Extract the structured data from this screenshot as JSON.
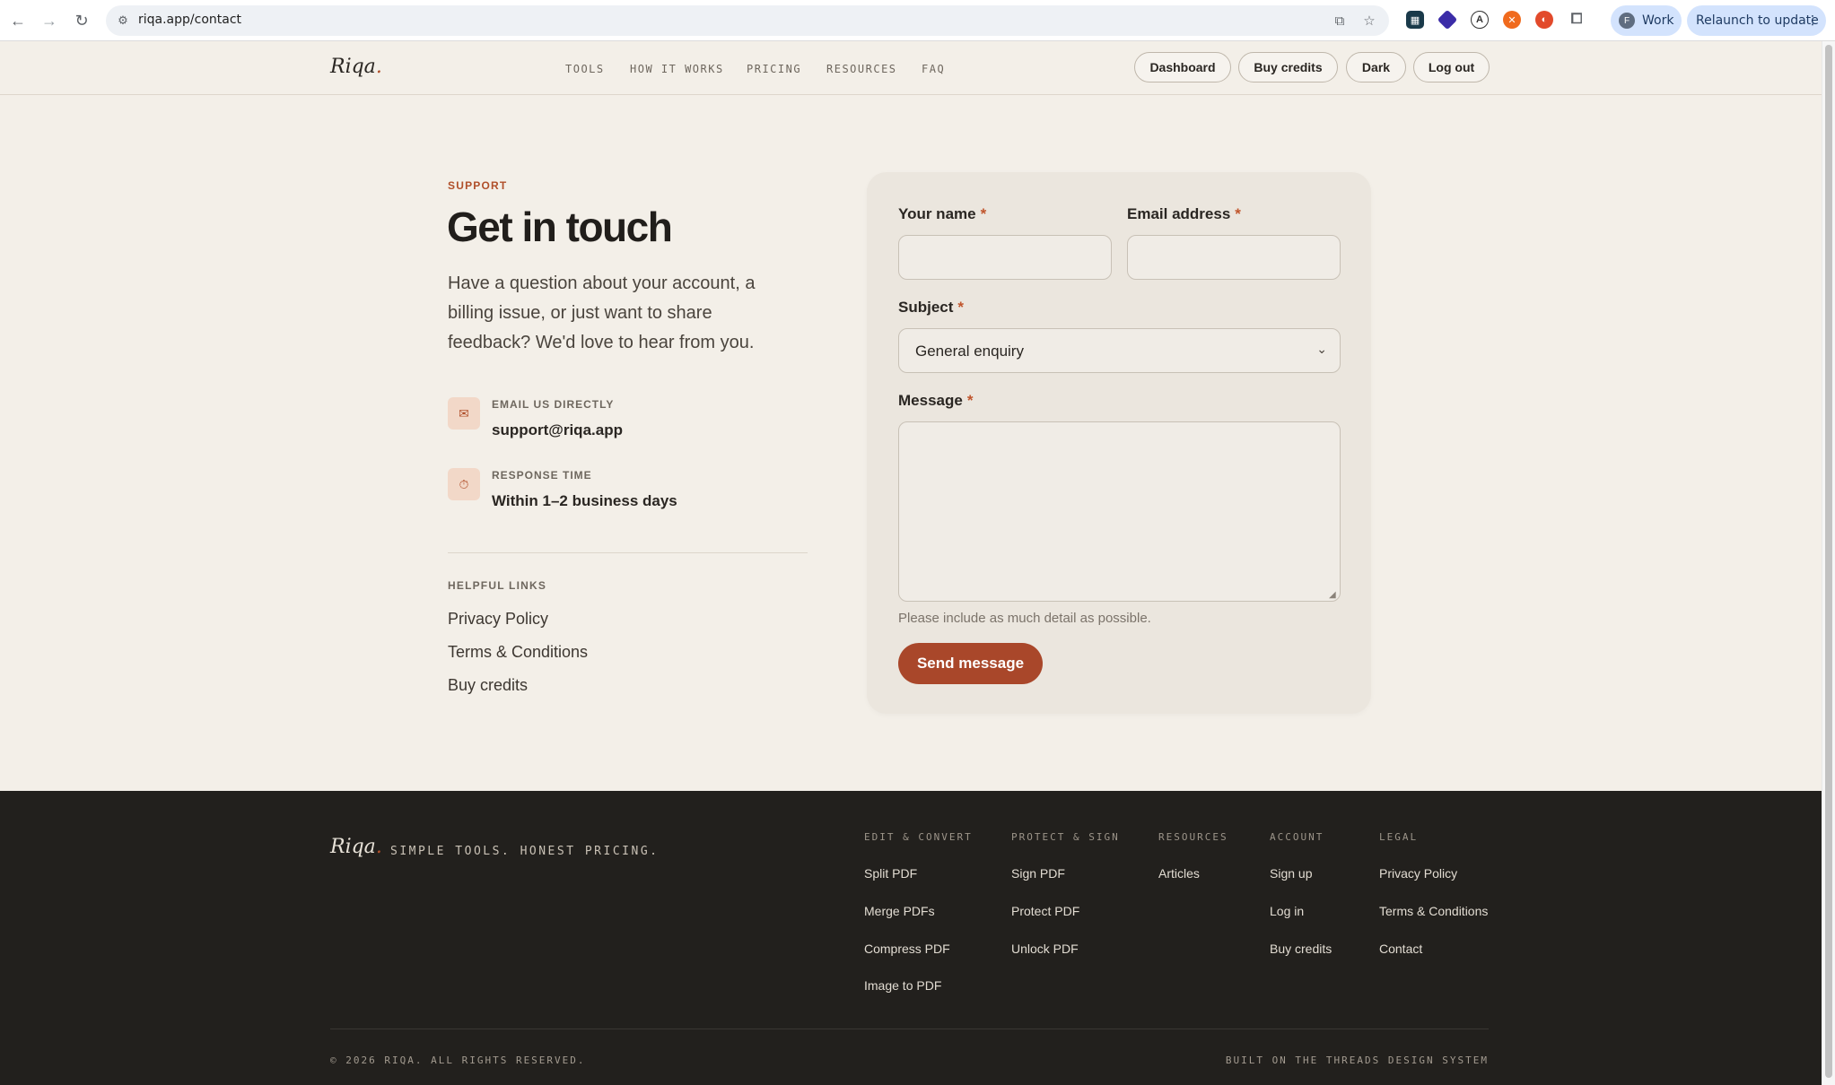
{
  "browser": {
    "url": "riqa.app/contact",
    "profile_initial": "F",
    "profile_label": "Work",
    "relaunch_label": "Relaunch to update"
  },
  "header": {
    "logo": "Riqa",
    "logo_dot": ".",
    "nav": [
      "TOOLS",
      "HOW IT WORKS",
      "PRICING",
      "RESOURCES",
      "FAQ"
    ],
    "buttons": [
      "Dashboard",
      "Buy credits",
      "Dark",
      "Log out"
    ]
  },
  "contact": {
    "eyebrow": "SUPPORT",
    "title": "Get in touch",
    "intro": "Have a question about your account, a billing issue, or just want to share feedback? We'd love to hear from you.",
    "email_label": "EMAIL US DIRECTLY",
    "email_value": "support@riqa.app",
    "response_label": "RESPONSE TIME",
    "response_value": "Within 1–2 business days",
    "helpful_label": "HELPFUL LINKS",
    "helpful_links": [
      "Privacy Policy",
      "Terms & Conditions",
      "Buy credits"
    ]
  },
  "form": {
    "name_label": "Your name",
    "email_label": "Email address",
    "subject_label": "Subject",
    "subject_value": "General enquiry",
    "message_label": "Message",
    "required_mark": "*",
    "hint": "Please include as much detail as possible.",
    "submit_label": "Send message"
  },
  "footer": {
    "logo": "Riqa",
    "logo_dot": ".",
    "tagline": "SIMPLE TOOLS. HONEST PRICING.",
    "columns": [
      {
        "title": "EDIT & CONVERT",
        "links": [
          "Split PDF",
          "Merge PDFs",
          "Compress PDF",
          "Image to PDF"
        ]
      },
      {
        "title": "PROTECT & SIGN",
        "links": [
          "Sign PDF",
          "Protect PDF",
          "Unlock PDF"
        ]
      },
      {
        "title": "RESOURCES",
        "links": [
          "Articles"
        ]
      },
      {
        "title": "ACCOUNT",
        "links": [
          "Sign up",
          "Log in",
          "Buy credits"
        ]
      },
      {
        "title": "LEGAL",
        "links": [
          "Privacy Policy",
          "Terms & Conditions",
          "Contact"
        ]
      }
    ],
    "copyright": "© 2026 RIQA. ALL RIGHTS RESERVED.",
    "built_on": "BUILT ON THE THREADS DESIGN SYSTEM"
  },
  "colors": {
    "accent": "#a9472a",
    "background": "#f3efe8",
    "footer_bg": "#22201d"
  }
}
